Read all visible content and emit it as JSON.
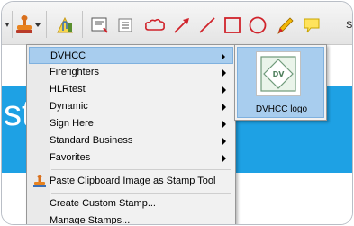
{
  "toolbar": {
    "truncated_label": "S",
    "icons": [
      "stamp-icon",
      "dropdown-arrow-icon",
      "attach-file-icon",
      "text-callout-icon",
      "text-box-icon",
      "cloud-icon",
      "arrow-icon",
      "line-icon",
      "rectangle-icon",
      "oval-icon",
      "pencil-icon",
      "sticky-note-icon"
    ]
  },
  "document": {
    "banner_text": "st",
    "banner_color": "#1ea1e4"
  },
  "stamp_menu": {
    "items": [
      {
        "label": "DVHCC",
        "has_submenu": true,
        "selected": true
      },
      {
        "label": "Firefighters",
        "has_submenu": true
      },
      {
        "label": "HLRtest",
        "has_submenu": true
      },
      {
        "label": "Dynamic",
        "has_submenu": true
      },
      {
        "label": "Sign Here",
        "has_submenu": true
      },
      {
        "label": "Standard Business",
        "has_submenu": true
      },
      {
        "label": "Favorites",
        "has_submenu": true
      }
    ],
    "paste_clipboard": "Paste Clipboard Image as Stamp Tool",
    "create_custom": "Create Custom Stamp...",
    "manage_stamps": "Manage Stamps..."
  },
  "submenu": {
    "stamp_label": "DVHCC logo",
    "thumb_text": "DV"
  },
  "colors": {
    "selection": "#a8cdee",
    "menu_bg": "#f1f1f1"
  }
}
